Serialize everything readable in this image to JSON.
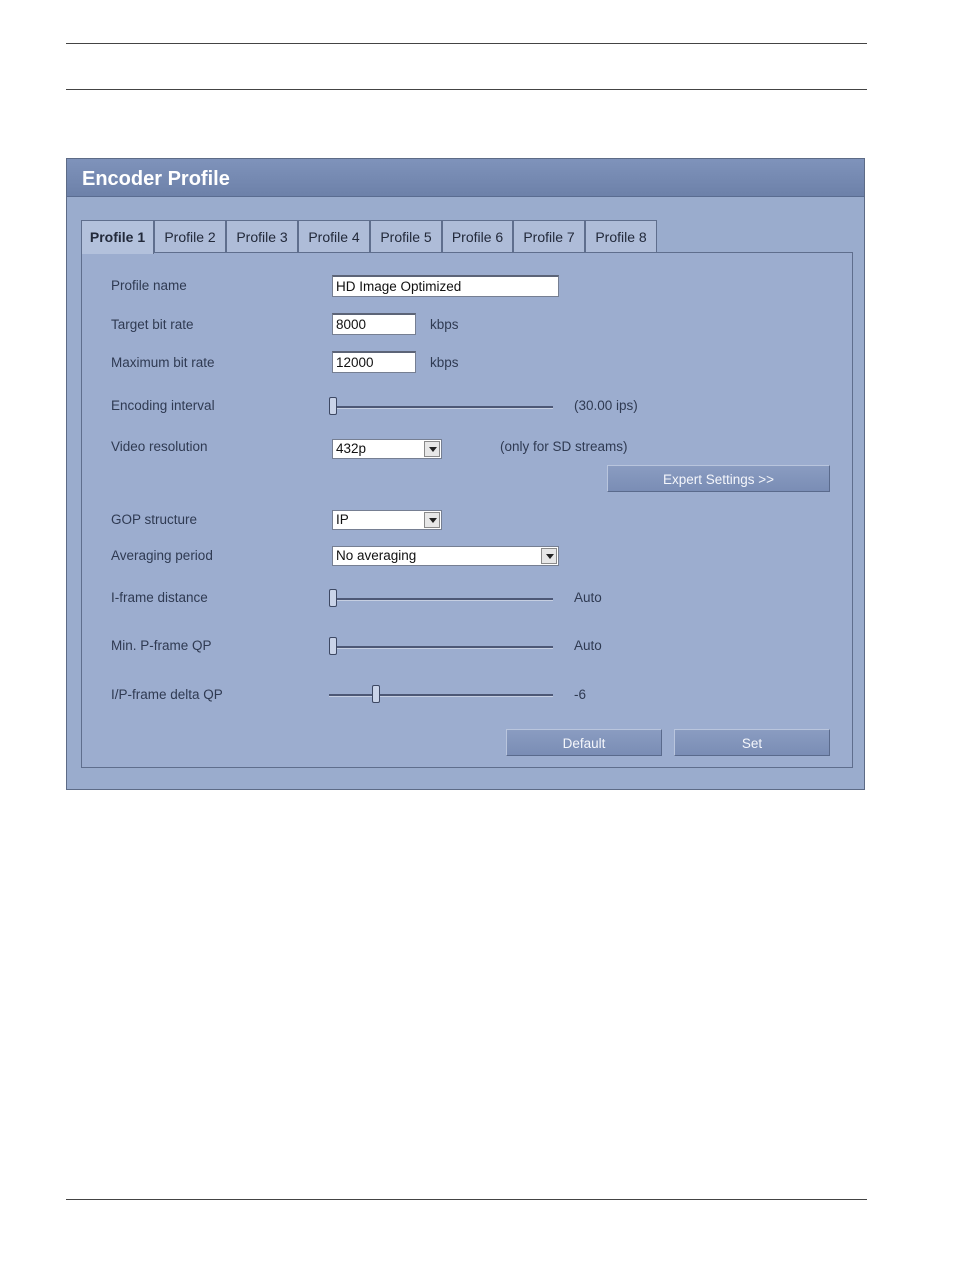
{
  "panel": {
    "title": "Encoder Profile"
  },
  "tabs": [
    {
      "label": "Profile 1",
      "active": true
    },
    {
      "label": "Profile 2",
      "active": false
    },
    {
      "label": "Profile 3",
      "active": false
    },
    {
      "label": "Profile 4",
      "active": false
    },
    {
      "label": "Profile 5",
      "active": false
    },
    {
      "label": "Profile 6",
      "active": false
    },
    {
      "label": "Profile 7",
      "active": false
    },
    {
      "label": "Profile 8",
      "active": false
    }
  ],
  "form": {
    "profile_name": {
      "label": "Profile name",
      "value": "HD Image Optimized"
    },
    "target_bit_rate": {
      "label": "Target bit rate",
      "value": "8000",
      "unit": "kbps"
    },
    "maximum_bit_rate": {
      "label": "Maximum bit rate",
      "value": "12000",
      "unit": "kbps"
    },
    "encoding_interval": {
      "label": "Encoding interval",
      "readout": "(30.00 ips)",
      "level": 0
    },
    "video_resolution": {
      "label": "Video resolution",
      "selected": "432p",
      "note": "(only for SD streams)"
    },
    "expert_settings": {
      "label": "Expert Settings >>"
    },
    "gop_structure": {
      "label": "GOP structure",
      "selected": "IP"
    },
    "averaging_period": {
      "label": "Averaging period",
      "selected": "No averaging"
    },
    "iframe_distance": {
      "label": "I-frame distance",
      "readout": "Auto",
      "level": 0
    },
    "min_pframe_qp": {
      "label": "Min. P-frame QP",
      "readout": "Auto",
      "level": 0
    },
    "ip_delta_qp": {
      "label": "I/P-frame delta QP",
      "readout": "-6",
      "level": 0.2
    }
  },
  "buttons": {
    "default": "Default",
    "set": "Set"
  }
}
